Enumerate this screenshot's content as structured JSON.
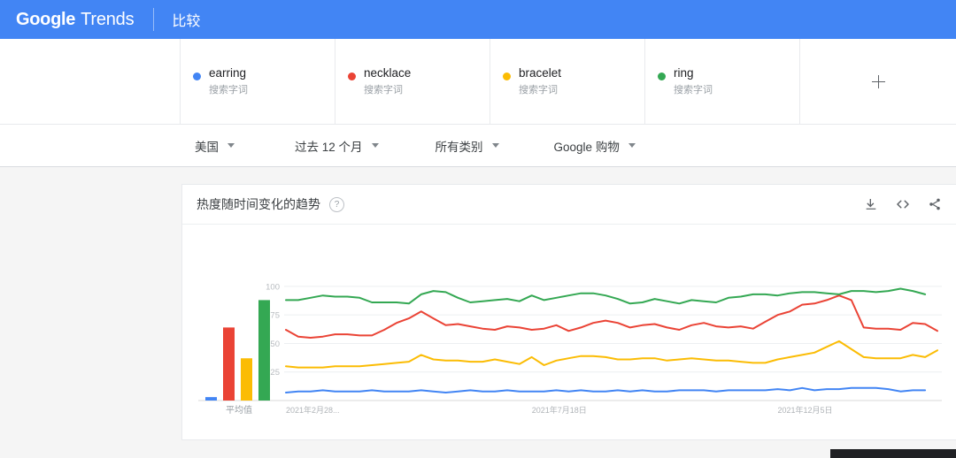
{
  "app": {
    "brand_google": "Google",
    "brand_trends": "Trends",
    "section": "比较",
    "header_color": "#4285f4"
  },
  "terms": {
    "items": [
      {
        "name": "earring",
        "type": "搜索字词",
        "color": "#4285f4",
        "icon": "legend-dot"
      },
      {
        "name": "necklace",
        "type": "搜索字词",
        "color": "#ea4335",
        "icon": "legend-dot"
      },
      {
        "name": "bracelet",
        "type": "搜索字词",
        "color": "#fbbc04",
        "icon": "legend-dot"
      },
      {
        "name": "ring",
        "type": "搜索字词",
        "color": "#34a853",
        "icon": "legend-dot"
      }
    ],
    "add_icon": "plus-icon"
  },
  "filters": {
    "region": "美国",
    "time": "过去 12 个月",
    "category": "所有类别",
    "property": "Google 购物",
    "caret_icon": "chevron-down-icon"
  },
  "card": {
    "title": "热度随时间变化的趋势",
    "help_icon": "help-circle-icon",
    "download_icon": "download-icon",
    "embed_icon": "embed-code-icon",
    "share_icon": "share-icon"
  },
  "chart_data": {
    "type": "line",
    "title": "热度随时间变化的趋势",
    "xlabel": "",
    "ylabel": "",
    "ylim": [
      0,
      110
    ],
    "yticks": [
      25,
      50,
      75,
      100
    ],
    "grid": true,
    "legend_position": "top-cards",
    "xtick_labels": [
      "2021年2月28...",
      "2021年7月18日",
      "2021年12月5日"
    ],
    "xtick_positions": [
      0,
      20,
      40
    ],
    "n_points": 53,
    "series": [
      {
        "name": "earring",
        "color": "#4285f4",
        "values": [
          7,
          8,
          8,
          9,
          8,
          8,
          8,
          9,
          8,
          8,
          8,
          9,
          8,
          7,
          8,
          9,
          8,
          8,
          9,
          8,
          8,
          8,
          9,
          8,
          9,
          8,
          8,
          9,
          8,
          9,
          8,
          8,
          9,
          9,
          9,
          8,
          9,
          9,
          9,
          9,
          10,
          9,
          11,
          9,
          10,
          10,
          11,
          11,
          11,
          10,
          8,
          9,
          9
        ]
      },
      {
        "name": "necklace",
        "color": "#ea4335",
        "values": [
          62,
          56,
          55,
          56,
          58,
          58,
          57,
          57,
          62,
          68,
          72,
          78,
          72,
          66,
          67,
          65,
          63,
          62,
          65,
          64,
          62,
          63,
          66,
          61,
          64,
          68,
          70,
          68,
          64,
          66,
          67,
          64,
          62,
          66,
          68,
          65,
          64,
          65,
          63,
          69,
          75,
          78,
          84,
          85,
          88,
          92,
          88,
          64,
          63,
          63,
          62,
          68,
          67,
          61
        ]
      },
      {
        "name": "bracelet",
        "color": "#fbbc04",
        "values": [
          30,
          29,
          29,
          29,
          30,
          30,
          30,
          31,
          32,
          33,
          34,
          40,
          36,
          35,
          35,
          34,
          34,
          36,
          34,
          32,
          38,
          31,
          35,
          37,
          39,
          39,
          38,
          36,
          36,
          37,
          37,
          35,
          36,
          37,
          36,
          35,
          35,
          34,
          33,
          33,
          36,
          38,
          40,
          42,
          47,
          52,
          45,
          38,
          37,
          37,
          37,
          40,
          38,
          44
        ]
      },
      {
        "name": "ring",
        "color": "#34a853",
        "values": [
          88,
          88,
          90,
          92,
          91,
          91,
          90,
          86,
          86,
          86,
          85,
          93,
          96,
          95,
          90,
          86,
          87,
          88,
          89,
          87,
          92,
          88,
          90,
          92,
          94,
          94,
          92,
          89,
          85,
          86,
          89,
          87,
          85,
          88,
          87,
          86,
          90,
          91,
          93,
          93,
          92,
          94,
          95,
          95,
          94,
          93,
          96,
          96,
          95,
          96,
          98,
          96,
          93
        ]
      }
    ],
    "bar_panel": {
      "type": "bar",
      "caption": "平均值",
      "categories": [
        "earring",
        "necklace",
        "bracelet",
        "ring"
      ],
      "values": [
        3,
        64,
        37,
        88
      ],
      "colors": [
        "#4285f4",
        "#ea4335",
        "#fbbc04",
        "#34a853"
      ]
    }
  }
}
